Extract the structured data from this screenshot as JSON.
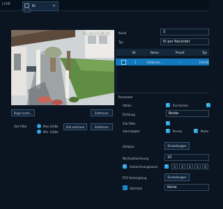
{
  "topbar": {
    "live_label": "LIVE",
    "tab_label": "KI"
  },
  "video": {
    "timestamp": "01-16 13:20:21"
  },
  "left": {
    "reset_button": "Regel zeich...",
    "delete_button": "Entfernen",
    "target_filter_label": "Ziel Filter",
    "radio_max": "Max Größe",
    "radio_min": "Min. Größe",
    "draw_target_button": "Ziel zeichnen",
    "delete_target_button": "Entfernen"
  },
  "right": {
    "channel_label": "Kanal",
    "channel_value": "3",
    "type_label": "Typ",
    "type_value": "KI per Recorder",
    "table": {
      "headers": [
        "Nr.",
        "Name",
        "Preset",
        "Typ"
      ],
      "rows": [
        [
          "1",
          "Fallkonze...",
          "--",
          "Eintritt"
        ]
      ]
    },
    "params_title": "Parameter",
    "action_label": "Aktion",
    "action_value": "Erscheinen",
    "direction_label": "Richtung",
    "direction_value": "Beide",
    "target_filter_label": "Ziel Filter",
    "alarm_object_label": "Alarmobjekt",
    "alarm_person": "Person",
    "alarm_vehicle": "Motor",
    "schedule_label": "Zeitplan",
    "settings_button": "Einstellungen",
    "postrecord_label": "Nachaufzeichnung",
    "postrecord_value": "10",
    "record_channel_label": "Aufzeichnungskanal",
    "channel_numbers": [
      "1",
      "2",
      "3",
      "4",
      "5",
      "6"
    ],
    "ptz_label": "PTZ Verknüpfung",
    "ptz_button": "Einstellungen",
    "alarm_out_label": "Alarmton",
    "alarm_out_value": "Keine"
  },
  "colors": {
    "accent": "#2fa8e6",
    "selected_row": "#1379bd",
    "background": "#0b1521"
  }
}
